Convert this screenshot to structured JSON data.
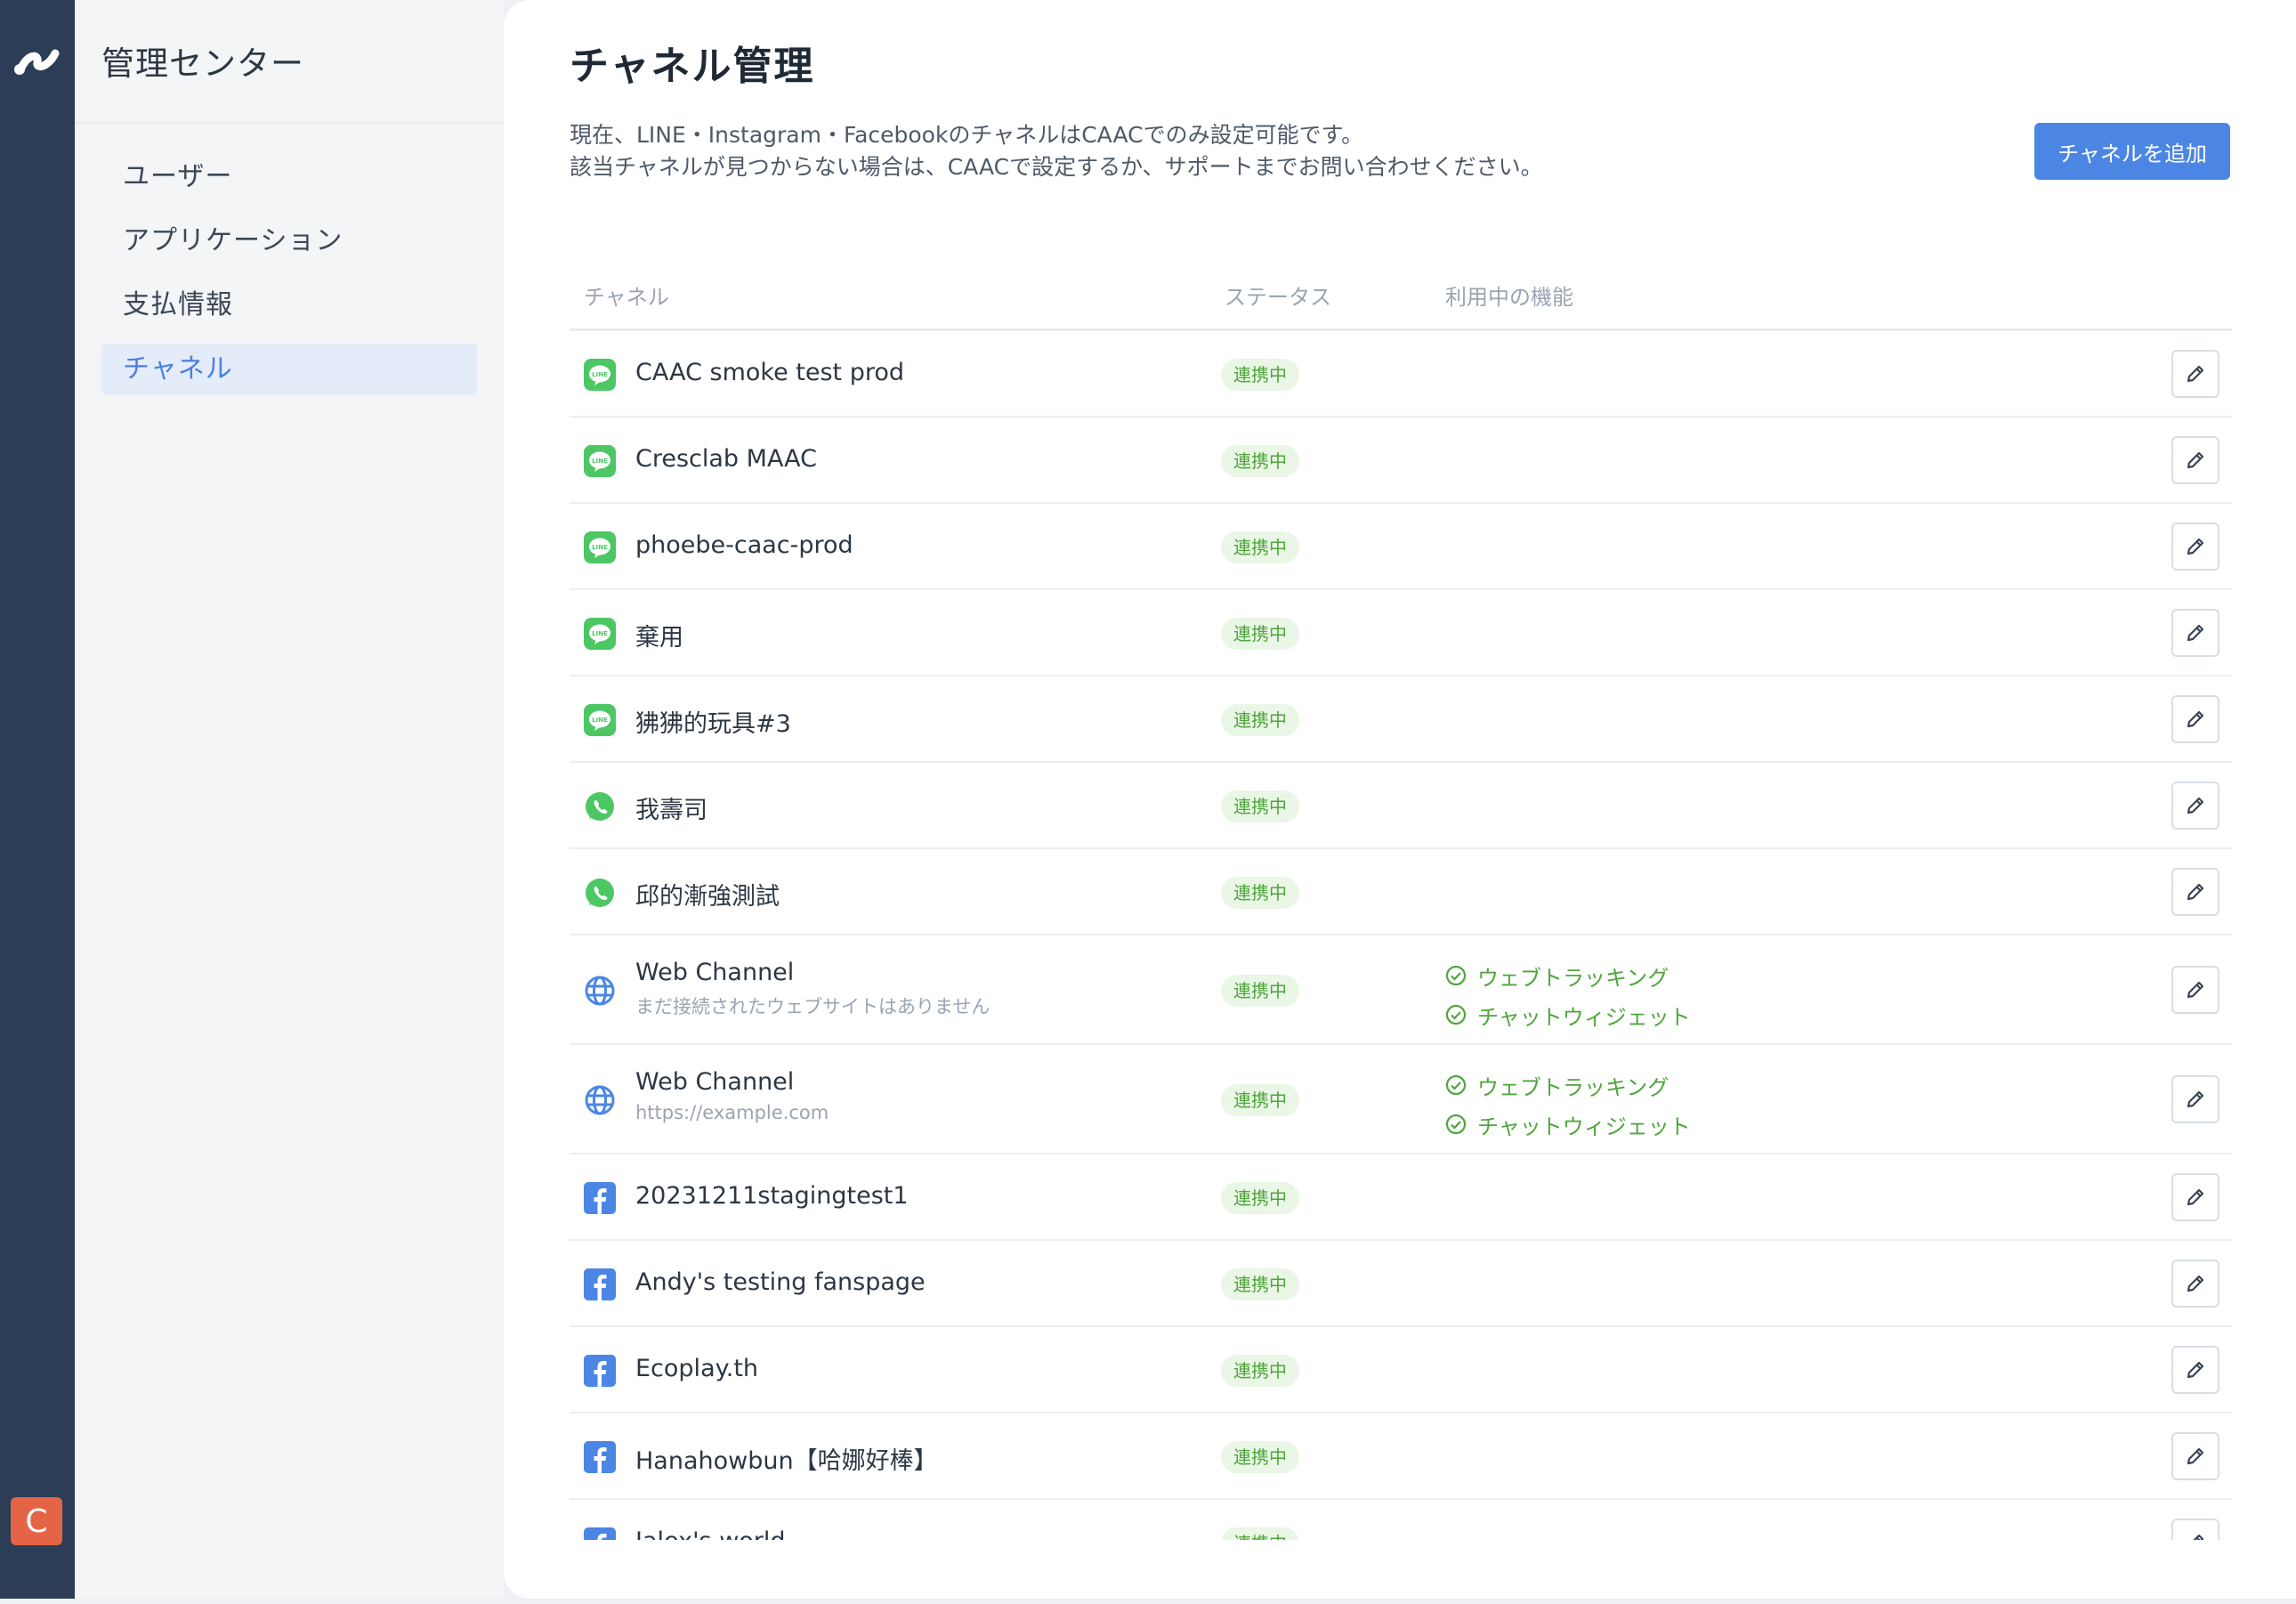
{
  "sidebar": {
    "title": "管理センター",
    "items": [
      {
        "label": "ユーザー",
        "active": false
      },
      {
        "label": "アプリケーション",
        "active": false
      },
      {
        "label": "支払情報",
        "active": false
      },
      {
        "label": "チャネル",
        "active": true
      }
    ],
    "avatar_initial": "C"
  },
  "page": {
    "title": "チャネル管理",
    "description_line1": "現在、LINE・Instagram・FacebookのチャネルはCAACでのみ設定可能です。",
    "description_line2": "該当チャネルが見つからない場合は、CAACで設定するか、サポートまでお問い合わせください。",
    "add_button": "チャネルを追加"
  },
  "table": {
    "headers": {
      "channel": "チャネル",
      "status": "ステータス",
      "features": "利用中の機能"
    },
    "rows": [
      {
        "type": "line",
        "name": "CAAC smoke test prod",
        "sub": "",
        "status": "連携中",
        "features": []
      },
      {
        "type": "line",
        "name": "Cresclab MAAC",
        "sub": "",
        "status": "連携中",
        "features": []
      },
      {
        "type": "line",
        "name": "phoebe-caac-prod",
        "sub": "",
        "status": "連携中",
        "features": []
      },
      {
        "type": "line",
        "name": "棄用",
        "sub": "",
        "status": "連携中",
        "features": []
      },
      {
        "type": "line",
        "name": "狒狒的玩具#3",
        "sub": "",
        "status": "連携中",
        "features": []
      },
      {
        "type": "whatsapp",
        "name": "我壽司",
        "sub": "",
        "status": "連携中",
        "features": []
      },
      {
        "type": "whatsapp",
        "name": "邱的漸強測試",
        "sub": "",
        "status": "連携中",
        "features": []
      },
      {
        "type": "web",
        "name": "Web Channel",
        "sub": "まだ接続されたウェブサイトはありません",
        "status": "連携中",
        "features": [
          "ウェブトラッキング",
          "チャットウィジェット"
        ]
      },
      {
        "type": "web",
        "name": "Web Channel",
        "sub": "https://example.com",
        "status": "連携中",
        "features": [
          "ウェブトラッキング",
          "チャットウィジェット"
        ]
      },
      {
        "type": "facebook",
        "name": "20231211stagingtest1",
        "sub": "",
        "status": "連携中",
        "features": []
      },
      {
        "type": "facebook",
        "name": "Andy's testing fanspage",
        "sub": "",
        "status": "連携中",
        "features": []
      },
      {
        "type": "facebook",
        "name": "Ecoplay.th",
        "sub": "",
        "status": "連携中",
        "features": []
      },
      {
        "type": "facebook",
        "name": "Hanahowbun【哈娜好棒】",
        "sub": "",
        "status": "連携中",
        "features": []
      },
      {
        "type": "facebook",
        "name": "Jalex's world",
        "sub": "",
        "status": "連携中",
        "features": []
      }
    ]
  },
  "colors": {
    "line": "#4cc764",
    "whatsapp": "#4cc764",
    "web": "#4c86e4",
    "facebook": "#4c86e4",
    "accent": "#4c86e4",
    "status_green": "#4ea63b"
  }
}
